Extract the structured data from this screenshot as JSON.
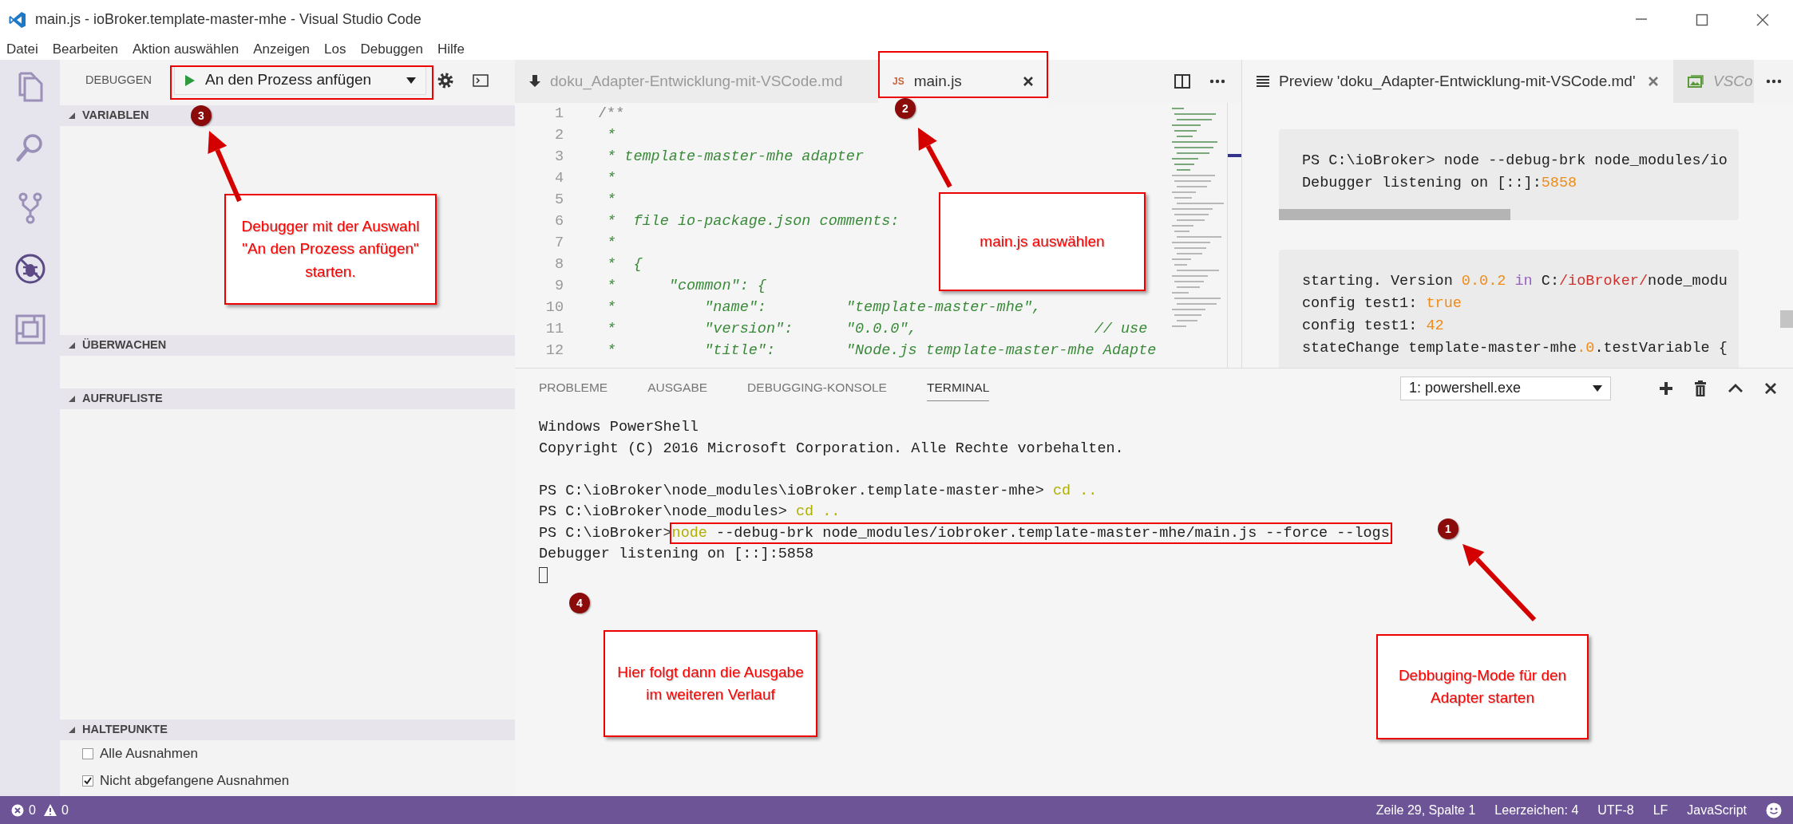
{
  "window": {
    "title": "main.js - ioBroker.template-master-mhe - Visual Studio Code"
  },
  "menu": [
    "Datei",
    "Bearbeiten",
    "Aktion auswählen",
    "Anzeigen",
    "Los",
    "Debuggen",
    "Hilfe"
  ],
  "activity_bar": [
    {
      "kind": "files",
      "selected": false
    },
    {
      "kind": "search",
      "selected": false
    },
    {
      "kind": "git",
      "selected": false
    },
    {
      "kind": "debug",
      "selected": true
    },
    {
      "kind": "extensions",
      "selected": false
    }
  ],
  "debug_toolbar": {
    "title": "DEBUGGEN",
    "configuration": "An den Prozess anfügen"
  },
  "sidebar_sections": [
    {
      "title": "VARIABLEN",
      "expanded": true
    },
    {
      "title": "ÜBERWACHEN",
      "expanded": true
    },
    {
      "title": "AUFRUFLISTE",
      "expanded": true
    },
    {
      "title": "HALTEPUNKTE",
      "expanded": true,
      "items": [
        {
          "label": "Alle Ausnahmen",
          "checked": false
        },
        {
          "label": "Nicht abgefangene Ausnahmen",
          "checked": true
        }
      ]
    }
  ],
  "editor_tabs": [
    {
      "kind": "markdown",
      "label": "doku_Adapter-Entwicklung-mit-VSCode.md",
      "selected": false
    },
    {
      "kind": "js",
      "badge": "JS",
      "label": "main.js",
      "selected": true
    }
  ],
  "code_lines": [
    {
      "number": "1",
      "kind": "doc",
      "text": "/**"
    },
    {
      "number": "2",
      "kind": "comment",
      "text": " *"
    },
    {
      "number": "3",
      "kind": "comment",
      "text": " * template-master-mhe adapter"
    },
    {
      "number": "4",
      "kind": "comment",
      "text": " *"
    },
    {
      "number": "5",
      "kind": "comment",
      "text": " *"
    },
    {
      "number": "6",
      "kind": "comment",
      "text": " *  file io-package.json comments:"
    },
    {
      "number": "7",
      "kind": "comment",
      "text": " *"
    },
    {
      "number": "8",
      "kind": "comment",
      "text": " *  {"
    },
    {
      "number": "9",
      "kind": "comment",
      "text": " *      \"common\": {"
    },
    {
      "number": "10",
      "kind": "comment",
      "text": " *          \"name\":         \"template-master-mhe\","
    },
    {
      "number": "11",
      "kind": "comment",
      "text": " *          \"version\":      \"0.0.0\",                    // use"
    },
    {
      "number": "12",
      "kind": "comment",
      "text": " *          \"title\":        \"Node.js template-master-mhe Adapte"
    }
  ],
  "preview_tabs": [
    {
      "kind": "preview",
      "label": "Preview 'doku_Adapter-Entwicklung-mit-VSCode.md'",
      "selected": true
    },
    {
      "kind": "image",
      "label": "VSCo",
      "selected": false
    }
  ],
  "preview_blocks": [
    {
      "lines": [
        [
          {
            "text": "PS C:\\ioBroker> node --debug-brk node_modules/io",
            "kind": "plain"
          }
        ],
        [
          {
            "text": "Debugger listening on [::]:",
            "kind": "plain"
          },
          {
            "text": "5858",
            "kind": "number"
          }
        ]
      ]
    },
    {
      "lines": [
        [
          {
            "text": "starting. Version ",
            "kind": "plain"
          },
          {
            "text": "0.0.2 ",
            "kind": "number"
          },
          {
            "text": "in",
            "kind": "keyword"
          },
          {
            "text": " C:",
            "kind": "plain"
          },
          {
            "text": "/ioBroker/",
            "kind": "path"
          },
          {
            "text": "node_modu",
            "kind": "plain"
          }
        ],
        [
          {
            "text": "config test1: ",
            "kind": "plain"
          },
          {
            "text": "true",
            "kind": "number"
          }
        ],
        [
          {
            "text": "config test1: ",
            "kind": "plain"
          },
          {
            "text": "42",
            "kind": "number"
          }
        ],
        [
          {
            "text": "stateChange template-master-mhe",
            "kind": "plain"
          },
          {
            "text": ".0",
            "kind": "number"
          },
          {
            "text": ".testVariable {",
            "kind": "plain"
          }
        ]
      ]
    }
  ],
  "panel_tabs": [
    {
      "label": "PROBLEME",
      "selected": false
    },
    {
      "label": "AUSGABE",
      "selected": false
    },
    {
      "label": "DEBUGGING-KONSOLE",
      "selected": false
    },
    {
      "label": "TERMINAL",
      "selected": true
    }
  ],
  "terminal_select": "1: powershell.exe",
  "terminal_lines": [
    {
      "kind": "output",
      "tokens": [
        {
          "text": "Windows PowerShell",
          "kind": "plain"
        }
      ]
    },
    {
      "kind": "output",
      "tokens": [
        {
          "text": "Copyright (C) 2016 Microsoft Corporation. Alle Rechte vorbehalten.",
          "kind": "plain"
        }
      ]
    },
    {
      "kind": "blank"
    },
    {
      "kind": "output",
      "tokens": [
        {
          "text": "PS C:\\ioBroker\\node_modules\\ioBroker.template-master-mhe> ",
          "kind": "plain"
        },
        {
          "text": "cd ..",
          "kind": "command"
        }
      ]
    },
    {
      "kind": "output",
      "tokens": [
        {
          "text": "PS C:\\ioBroker\\node_modules> ",
          "kind": "plain"
        },
        {
          "text": "cd ..",
          "kind": "command"
        }
      ]
    },
    {
      "kind": "output",
      "tokens": [
        {
          "text": "PS C:\\ioBroker>",
          "kind": "plain"
        },
        {
          "text": "node",
          "kind": "command",
          "framed": true
        },
        {
          "text": " --debug-brk node_modules/iobroker.template-master-mhe/main.js --force --logs",
          "kind": "plain",
          "framed": true
        }
      ]
    },
    {
      "kind": "output",
      "tokens": [
        {
          "text": "Debugger listening on [::]:5858",
          "kind": "plain"
        }
      ]
    },
    {
      "kind": "cursor"
    }
  ],
  "status_bar": {
    "errors": "0",
    "warnings": "0",
    "items": [
      "Zeile 29, Spalte 1",
      "Leerzeichen: 4",
      "UTF-8",
      "LF",
      "JavaScript"
    ]
  },
  "annotations": [
    {
      "kind": "marker",
      "text": "3"
    },
    {
      "kind": "marker",
      "text": "2"
    },
    {
      "kind": "callout",
      "text": "Debugger mit der Auswahl \"An den Prozess anfügen\" starten."
    },
    {
      "kind": "callout",
      "text": "main.js auswählen"
    },
    {
      "kind": "marker",
      "text": "1"
    },
    {
      "kind": "marker",
      "text": "4"
    },
    {
      "kind": "callout",
      "text": "Hier folgt dann die Ausgabe im weiteren Verlauf"
    },
    {
      "kind": "callout",
      "text": "Debbuging-Mode für den Adapter starten"
    }
  ]
}
